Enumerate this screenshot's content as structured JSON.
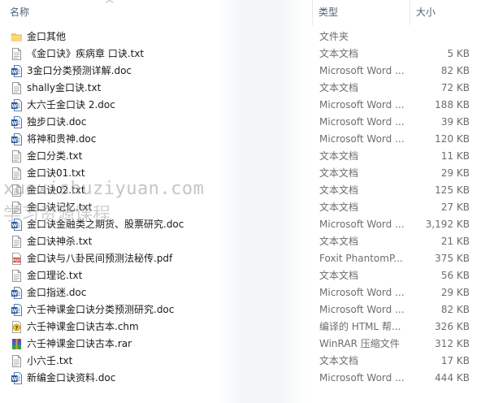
{
  "columns": {
    "name": "名称",
    "type": "类型",
    "size": "大小"
  },
  "watermark": {
    "line1": "xuexishuziyuan.com",
    "line2": "学习资源课程"
  },
  "files": [
    {
      "name": "金口其他",
      "type": "文件夹",
      "size": "",
      "icon": "folder-icon"
    },
    {
      "name": "《金口诀》疾病章 口诀.txt",
      "type": "文本文档",
      "size": "5 KB",
      "icon": "text-file-icon"
    },
    {
      "name": "3金口分类预测详解.doc",
      "type": "Microsoft Word ...",
      "size": "82 KB",
      "icon": "word-doc-icon"
    },
    {
      "name": "shally金口诀.txt",
      "type": "文本文档",
      "size": "72 KB",
      "icon": "text-file-icon"
    },
    {
      "name": "大六壬金口诀 2.doc",
      "type": "Microsoft Word ...",
      "size": "188 KB",
      "icon": "word-doc-icon"
    },
    {
      "name": "独步口诀.doc",
      "type": "Microsoft Word ...",
      "size": "39 KB",
      "icon": "word-doc-icon"
    },
    {
      "name": "将神和贵神.doc",
      "type": "Microsoft Word ...",
      "size": "120 KB",
      "icon": "word-doc-icon"
    },
    {
      "name": "金口分类.txt",
      "type": "文本文档",
      "size": "11 KB",
      "icon": "text-file-icon"
    },
    {
      "name": "金口诀01.txt",
      "type": "文本文档",
      "size": "29 KB",
      "icon": "text-file-icon"
    },
    {
      "name": "金口诀02.txt",
      "type": "文本文档",
      "size": "125 KB",
      "icon": "text-file-icon"
    },
    {
      "name": "金口诀记忆.txt",
      "type": "文本文档",
      "size": "27 KB",
      "icon": "text-file-icon"
    },
    {
      "name": "金口诀金融类之期货、股票研究.doc",
      "type": "Microsoft Word ...",
      "size": "3,192 KB",
      "icon": "word-doc-icon"
    },
    {
      "name": "金口诀神杀.txt",
      "type": "文本文档",
      "size": "21 KB",
      "icon": "text-file-icon"
    },
    {
      "name": "金口诀与八卦民间预测法秘传.pdf",
      "type": "Foxit PhantomP...",
      "size": "375 KB",
      "icon": "pdf-file-icon"
    },
    {
      "name": "金口理论.txt",
      "type": "文本文档",
      "size": "56 KB",
      "icon": "text-file-icon"
    },
    {
      "name": "金口指迷.doc",
      "type": "Microsoft Word ...",
      "size": "29 KB",
      "icon": "word-doc-icon"
    },
    {
      "name": "六壬神课金口诀分类预测研究.doc",
      "type": "Microsoft Word ...",
      "size": "82 KB",
      "icon": "word-doc-icon"
    },
    {
      "name": "六壬神课金口诀古本.chm",
      "type": "编译的 HTML 帮...",
      "size": "326 KB",
      "icon": "chm-help-icon"
    },
    {
      "name": "六壬神课金口诀古本.rar",
      "type": "WinRAR 压缩文件",
      "size": "312 KB",
      "icon": "rar-archive-icon"
    },
    {
      "name": "小六壬.txt",
      "type": "文本文档",
      "size": "17 KB",
      "icon": "text-file-icon"
    },
    {
      "name": "新编金口诀资料.doc",
      "type": "Microsoft Word ...",
      "size": "444 KB",
      "icon": "word-doc-icon"
    }
  ]
}
